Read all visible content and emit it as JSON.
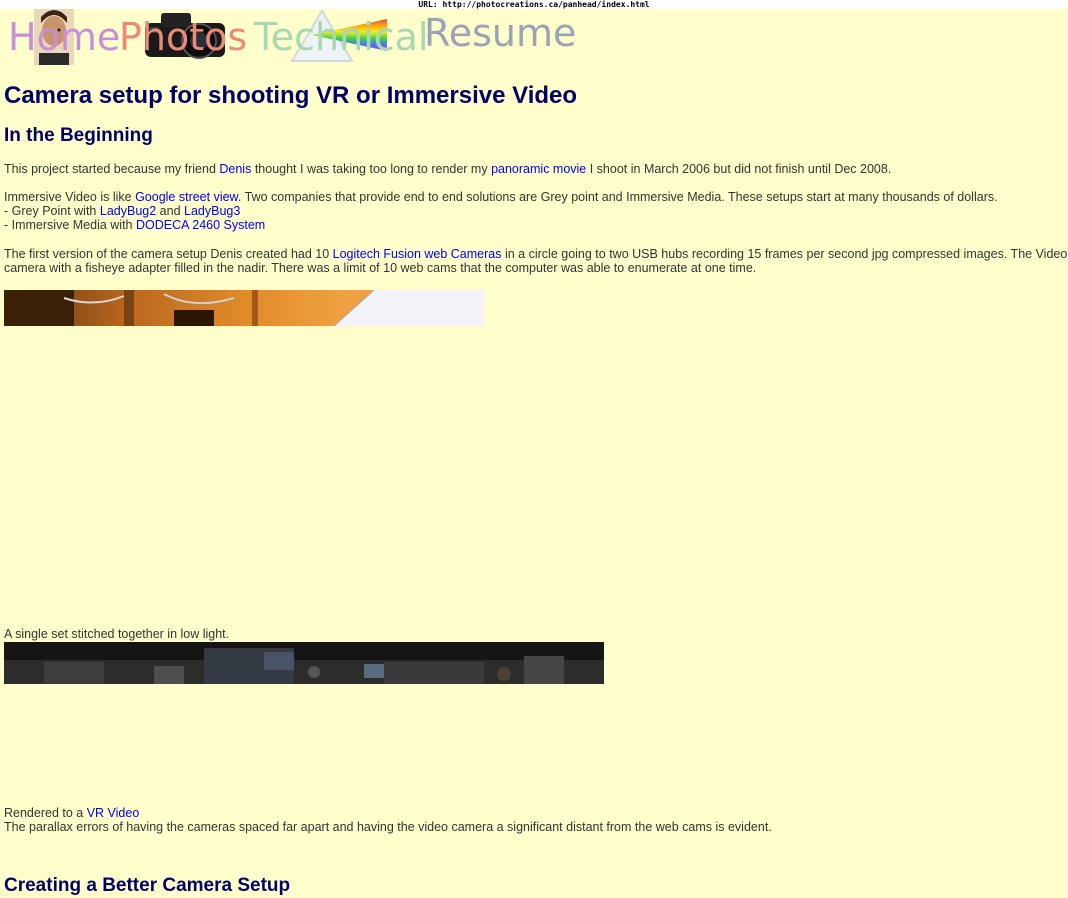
{
  "url_bar": {
    "text": "URL: http://photocreations.ca/panhead/index.html"
  },
  "nav": {
    "home": "Home",
    "photos": "Photos",
    "technical": "Technical",
    "resume": "Resume"
  },
  "page": {
    "title": "Camera setup for shooting VR or Immersive Video",
    "section1_heading": "In the Beginning",
    "para1": {
      "t1": "This project started because my friend ",
      "link1": "Denis",
      "t2": " thought I was taking too long to render my ",
      "link2": "panoramic movie",
      "t3": " I shoot in March 2006 but did not finish until Dec 2008."
    },
    "para2": {
      "t1": "Immersive Video is like ",
      "link1": "Google street view",
      "t2": ".  Two companies that provide end to end solutions are Grey point and Immersive Media.  These setups start at many thousands of dollars."
    },
    "list": {
      "item1_prefix": " - Grey Point with ",
      "item1_link1": "LadyBug2",
      "item1_and": " and ",
      "item1_link2": "LadyBug3",
      "item2_prefix": " - Immersive Media with ",
      "item2_link": "DODECA 2460 System"
    },
    "para3": {
      "t1": "The first version of the camera setup Denis created had 10 ",
      "link1": "Logitech Fusion web Cameras",
      "t2": " in a circle going to two USB hubs recording 15 frames per second jpg compressed images.  The Video",
      "line2": "camera with a fisheye adapter filled in the nadir.  There was a limit of 10 web cams that the computer was able to enumerate at one time."
    },
    "caption1": "A single set stitched together in low light.",
    "caption2_prefix": "Rendered to a ",
    "caption2_link": "VR Video",
    "caption3": "The parallax errors of having the cameras spaced far apart and having the video camera a significant distant from the web cams is evident.",
    "section2_heading": "Creating a Better Camera Setup"
  },
  "colors": {
    "background": "#ffffcc",
    "heading": "#000066",
    "link": "#0000ee",
    "text": "#333333"
  }
}
